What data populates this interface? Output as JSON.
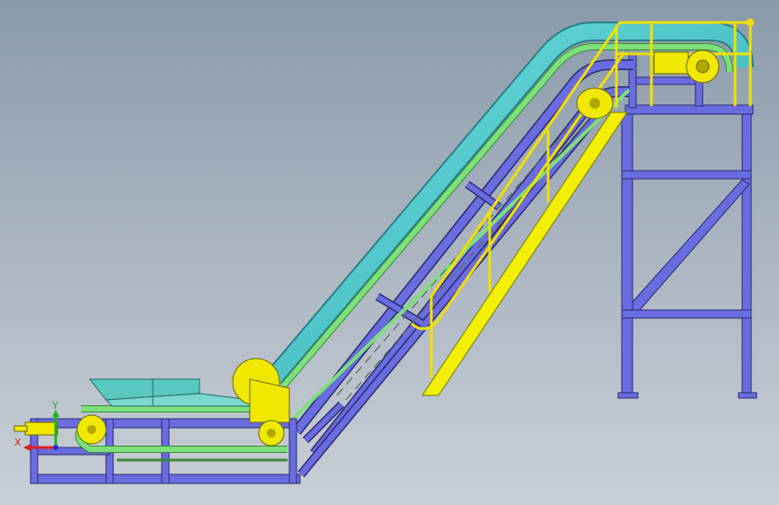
{
  "triad": {
    "x_label": "X",
    "y_label": "Y",
    "x_color": "#e02020",
    "y_color": "#20b020",
    "z_color": "#2030e0"
  },
  "colors": {
    "frame": "#6a6ce0",
    "frame_stroke": "#2a2a70",
    "belt_green": "#7ee07a",
    "belt_cyan": "#4fc8c8",
    "stairs": "#f2f000",
    "handrail": "#f0e000",
    "pulley": "#f0e800",
    "hopper": "#58c8c0"
  },
  "icons": [
    "coordinate-triad-icon"
  ]
}
